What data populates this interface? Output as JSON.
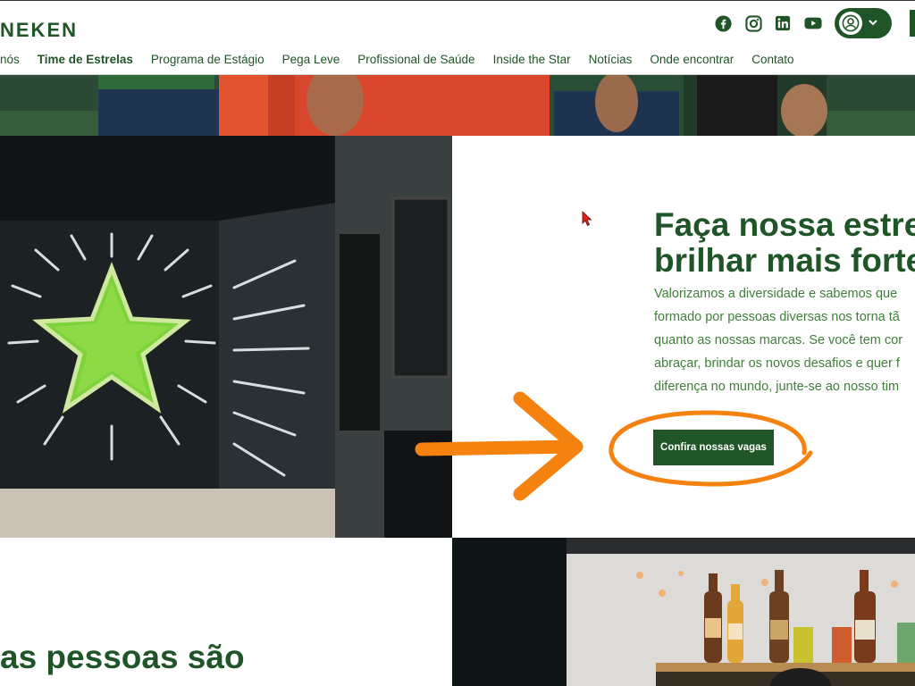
{
  "header": {
    "logo_text": "NEKEN",
    "nav": [
      {
        "label": "nós",
        "active": false
      },
      {
        "label": "Time de Estrelas",
        "active": true
      },
      {
        "label": "Programa de Estágio",
        "active": false
      },
      {
        "label": "Pega Leve",
        "active": false
      },
      {
        "label": "Profissional de Saúde",
        "active": false
      },
      {
        "label": "Inside the Star",
        "active": false
      },
      {
        "label": "Notícias",
        "active": false
      },
      {
        "label": "Onde encontrar",
        "active": false
      },
      {
        "label": "Contato",
        "active": false
      }
    ],
    "social_icons": [
      "facebook-icon",
      "instagram-icon",
      "linkedin-icon",
      "youtube-icon"
    ]
  },
  "hero": {
    "headline_line1": "Faça nossa estre",
    "headline_line2": "brilhar mais forte",
    "body_lines": [
      "Valorizamos a diversidade e sabemos que",
      "formado por pessoas diversas nos torna tã",
      "quanto as nossas marcas. Se você tem cor",
      "abraçar, brindar os novos desafios e quer f",
      "diferença no mundo, junte-se ao nosso tim"
    ],
    "cta_label": "Confira nossas vagas"
  },
  "section2": {
    "heading_partial": "as pessoas são"
  },
  "colors": {
    "brand_green": "#205527",
    "text_green": "#3f7f3a",
    "annotation_orange": "#f5820f"
  }
}
